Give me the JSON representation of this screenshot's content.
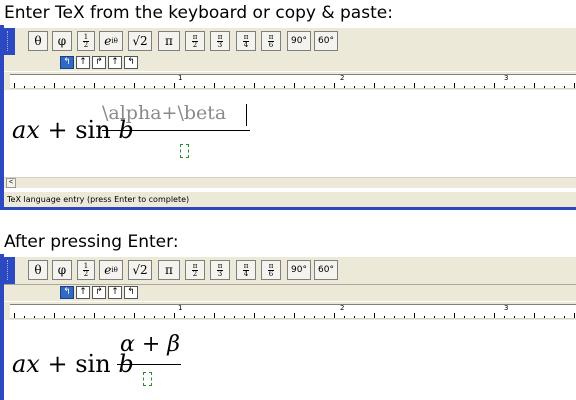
{
  "headings": {
    "first": "Enter TeX from the keyboard or copy & paste:",
    "second": "After pressing Enter:"
  },
  "toolbar": {
    "buttons": [
      "θ",
      "φ",
      "e",
      "√2",
      "π",
      "90°",
      "60°"
    ],
    "exp_sup": "iθ",
    "fractions": [
      [
        "1",
        "2"
      ],
      [
        "π",
        "2"
      ],
      [
        "π",
        "3"
      ],
      [
        "π",
        "4"
      ],
      [
        "π",
        "6"
      ]
    ]
  },
  "arrows": [
    "↰",
    "↑",
    "↱",
    "↑",
    "↰"
  ],
  "ruler": {
    "labels": [
      "1",
      "2",
      "3"
    ]
  },
  "formula": {
    "prefix": "ax",
    "plus": "+",
    "sin": "sin",
    "var": "b"
  },
  "tex_entry": "\\alpha+\\beta",
  "rendered_numerator": "α + β",
  "status": "TeX language entry (press Enter to complete)",
  "scroll_left": "<"
}
